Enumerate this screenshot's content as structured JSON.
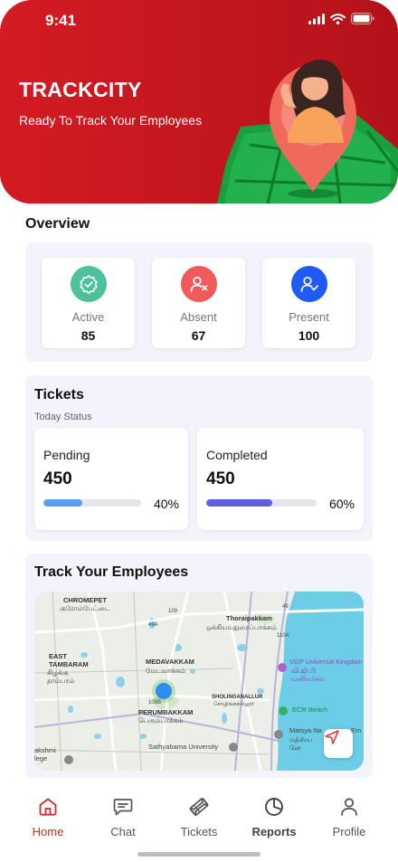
{
  "status_bar": {
    "time": "9:41"
  },
  "header": {
    "brand": "TRACKCITY",
    "tagline": "Ready To Track Your Employees",
    "bg_color": "#c8161d"
  },
  "overview": {
    "title": "Overview",
    "cards": [
      {
        "label": "Active",
        "value": "85",
        "icon": "check-badge-icon",
        "color": "#4cc19a"
      },
      {
        "label": "Absent",
        "value": "67",
        "icon": "user-x-icon",
        "color": "#f05a5a"
      },
      {
        "label": "Present",
        "value": "100",
        "icon": "user-check-icon",
        "color": "#1f5af5"
      }
    ]
  },
  "tickets": {
    "title": "Tickets",
    "subtitle": "Today Status",
    "cards": [
      {
        "label": "Pending",
        "value": "450",
        "percent_text": "40%",
        "progress": 0.4,
        "color": "#5aa0f0"
      },
      {
        "label": "Completed",
        "value": "450",
        "percent_text": "60%",
        "progress": 0.6,
        "color": "#5b5fe0"
      }
    ]
  },
  "track": {
    "title": "Track Your Employees",
    "map_labels": {
      "chromepet": "CHROMEPET",
      "chromepet_ta": "குரோம்பேட்டை",
      "thoraipakkam": "Thoraipakkam",
      "thoraipakkam_ta": "ஒக்கியம்துரைப்பாக்கம்",
      "east_tambaram": "EAST\nTAMBARAM",
      "east_tambaram_ta": "கிழக்கு\nதாம்பரம்",
      "medavakkam": "MEDAVAKKAM",
      "medavakkam_ta": "மேடவாக்கம்",
      "vgp": "VGP Universal Kingdom",
      "vgp_ta": "வி.ஜி.பி\nயுனிவர்சல்",
      "sholinganallur": "SHOLINGANALLUR",
      "sholinganallur_ta": "சோழிங்கநல்லூர்",
      "ecr_beach": "ECR Beach",
      "perumbakkam": "PERUMBAKKAM",
      "perumbakkam_ta": "பெரும்பாக்கம்",
      "matsya": "Matsya Na",
      "matsya_ta": "மத்ஸ்ய\nனே",
      "sathyabama": "Sathyabama University",
      "lakshmi": "akshmi\nlege",
      "road_109": "109",
      "road_49": "49",
      "road_49a": "49A",
      "road_109b": "109B",
      "road_110a": "110A",
      "road_em": "Em"
    }
  },
  "tabbar": {
    "items": [
      {
        "label": "Home",
        "icon": "home-icon",
        "active": true
      },
      {
        "label": "Chat",
        "icon": "chat-icon",
        "active": false
      },
      {
        "label": "Tickets",
        "icon": "ticket-icon",
        "active": false
      },
      {
        "label": "Reports",
        "icon": "pie-chart-icon",
        "active": false
      },
      {
        "label": "Profile",
        "icon": "user-icon",
        "active": false
      }
    ],
    "active_color": "#d42a2a"
  }
}
